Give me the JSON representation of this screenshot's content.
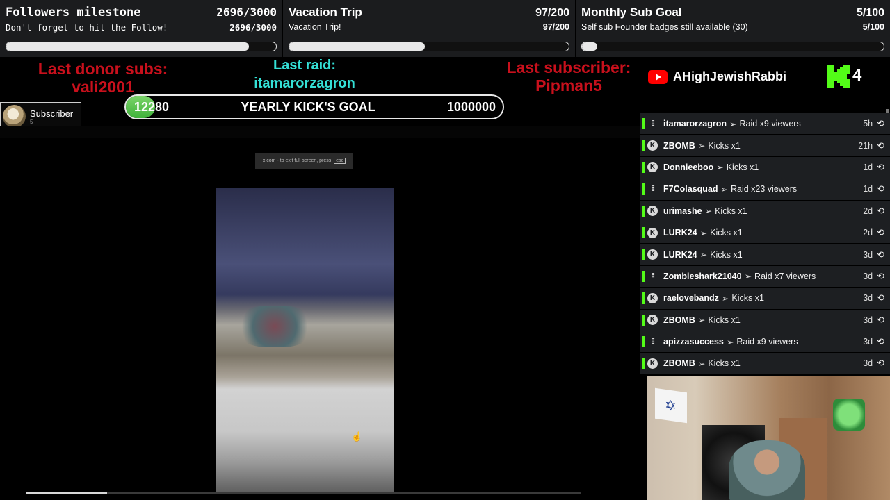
{
  "goals": [
    {
      "title": "Followers milestone",
      "count": "2696/3000",
      "subtitle": "Don't forget to hit the Follow!",
      "sub_count": "2696/3000",
      "progress": 0.899
    },
    {
      "title": "Vacation Trip",
      "count": "97/200",
      "subtitle": "Vacation Trip!",
      "sub_count": "97/200",
      "progress": 0.485
    },
    {
      "title": "Monthly Sub Goal",
      "count": "5/100",
      "subtitle": "Self sub Founder badges still available (30)",
      "sub_count": "5/100",
      "progress": 0.05
    }
  ],
  "last_donor": {
    "label": "Last donor subs:",
    "name": "vali2001"
  },
  "last_raid": {
    "label": "Last raid:",
    "name": "itamarorzagron"
  },
  "last_subscriber": {
    "label": "Last subscriber:",
    "name": "Pipman5"
  },
  "kick_goal": {
    "current": "12280",
    "label": "YEARLY KICK'S GOAL",
    "target": "1000000"
  },
  "subscriber_badge": {
    "label": "Subscriber",
    "count": "5"
  },
  "youtube": {
    "channel": "AHighJewishRabbi"
  },
  "kick": {
    "count": "4"
  },
  "video": {
    "banner_text": "x.com - to exit full screen, press",
    "banner_key": "esc",
    "progress": 0.145
  },
  "events": [
    {
      "type": "raid",
      "user": "itamarorzagron",
      "desc": "Raid x9 viewers",
      "time": "5h"
    },
    {
      "type": "kick",
      "user": "ZBOMB",
      "desc": "Kicks x1",
      "time": "21h"
    },
    {
      "type": "kick",
      "user": "Donnieeboo",
      "desc": "Kicks x1",
      "time": "1d"
    },
    {
      "type": "raid",
      "user": "F7Colasquad",
      "desc": "Raid x23 viewers",
      "time": "1d"
    },
    {
      "type": "kick",
      "user": "urimashe",
      "desc": "Kicks x1",
      "time": "2d"
    },
    {
      "type": "kick",
      "user": "LURK24",
      "desc": "Kicks x1",
      "time": "2d"
    },
    {
      "type": "kick",
      "user": "LURK24",
      "desc": "Kicks x1",
      "time": "3d"
    },
    {
      "type": "raid",
      "user": "Zombieshark21040",
      "desc": "Raid x7 viewers",
      "time": "3d"
    },
    {
      "type": "kick",
      "user": "raelovebandz",
      "desc": "Kicks x1",
      "time": "3d"
    },
    {
      "type": "kick",
      "user": "ZBOMB",
      "desc": "Kicks x1",
      "time": "3d"
    },
    {
      "type": "raid",
      "user": "apizzasuccess",
      "desc": "Raid x9 viewers",
      "time": "3d"
    },
    {
      "type": "kick",
      "user": "ZBOMB",
      "desc": "Kicks x1",
      "time": "3d"
    }
  ],
  "colors": {
    "accent_green": "#53fc18",
    "red_label": "#c8101c",
    "cyan_label": "#34e0d6"
  }
}
